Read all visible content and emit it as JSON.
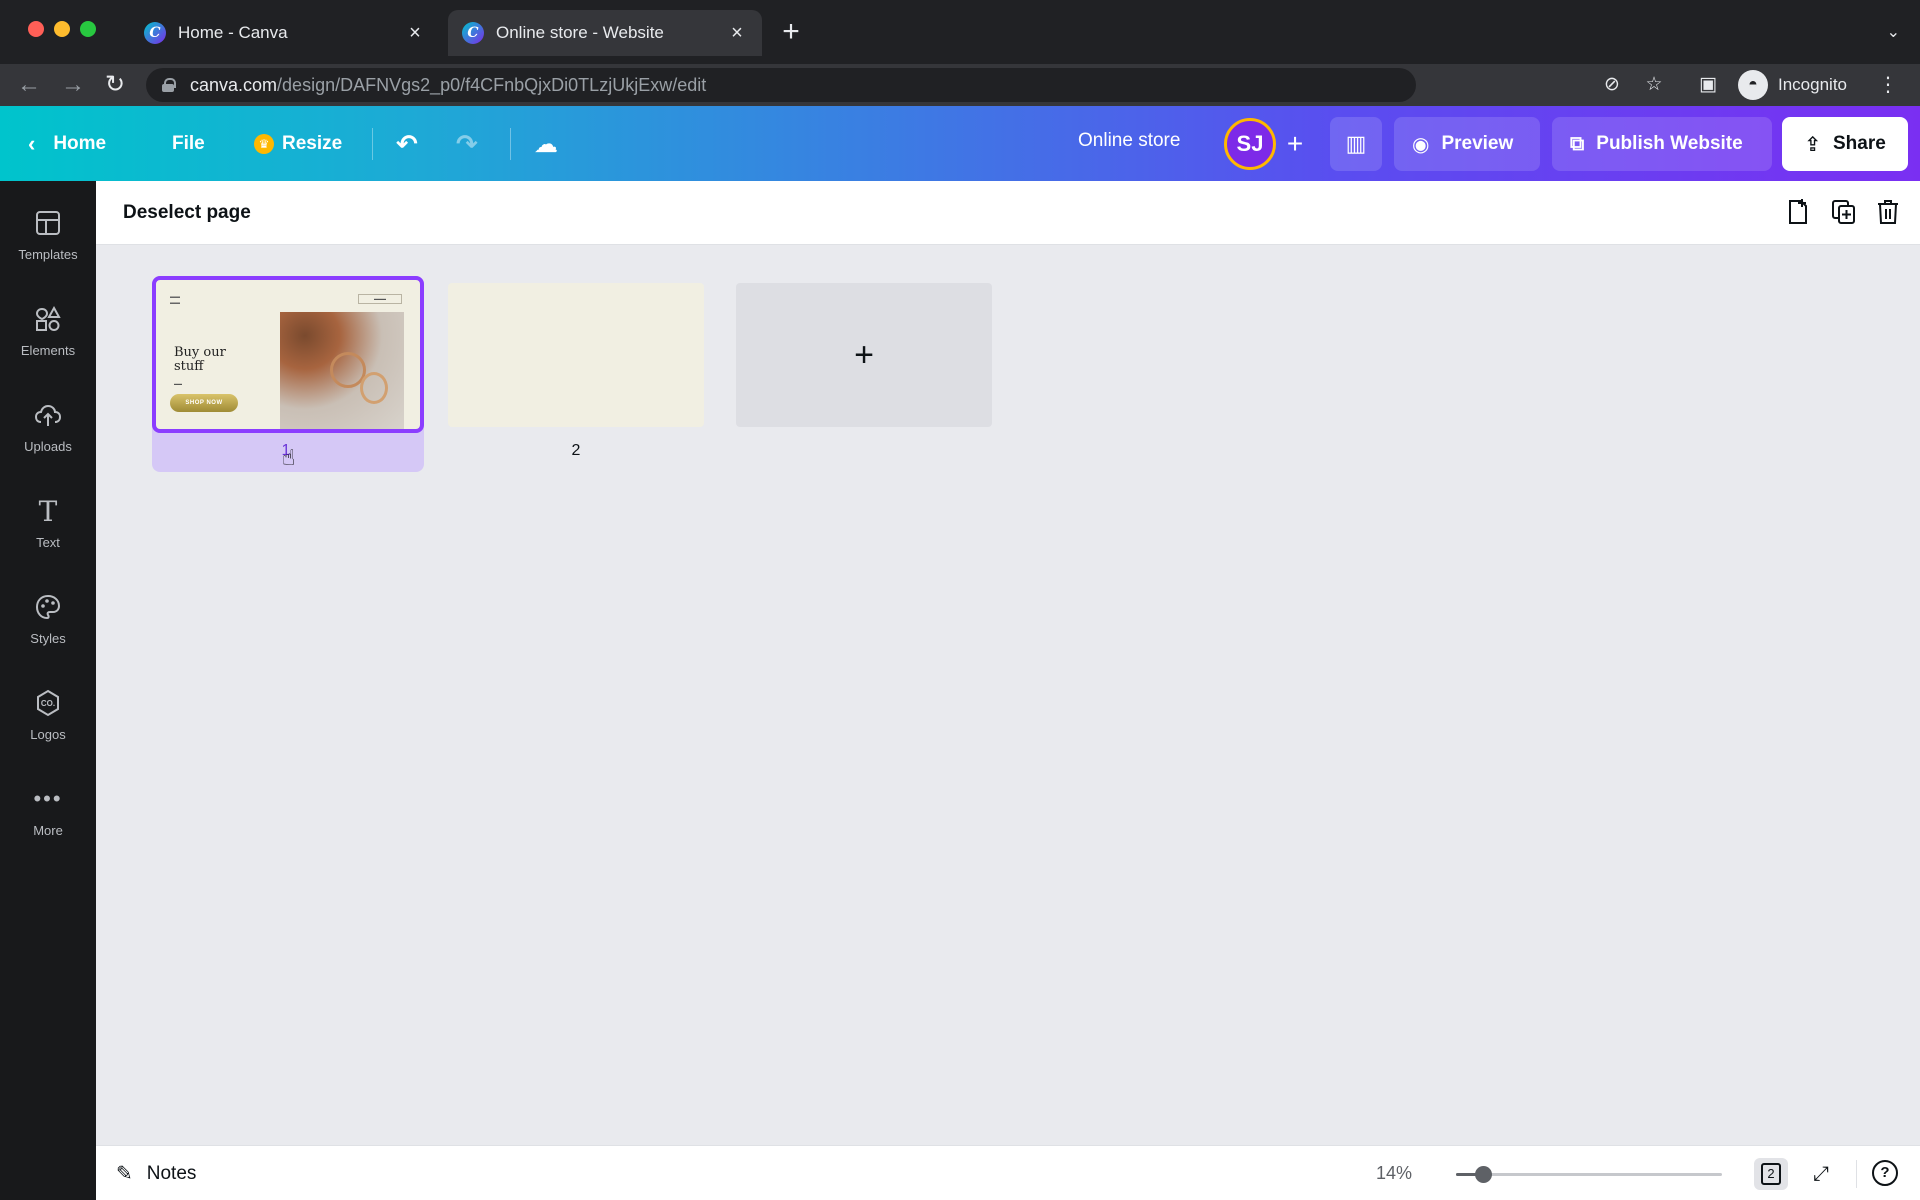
{
  "browser": {
    "tabs": [
      {
        "title": "Home - Canva",
        "active": false
      },
      {
        "title": "Online store - Website",
        "active": true
      }
    ],
    "url_domain": "canva.com",
    "url_path": "/design/DAFNVgs2_p0/f4CFnbQjxDi0TLzjUkjExw/edit",
    "profile_label": "Incognito"
  },
  "header": {
    "home_label": "Home",
    "file_label": "File",
    "resize_label": "Resize",
    "design_title": "Online store",
    "avatar_initials": "SJ",
    "preview_label": "Preview",
    "publish_label": "Publish Website",
    "share_label": "Share"
  },
  "sidebar": {
    "items": [
      {
        "label": "Templates",
        "icon": "templates-icon"
      },
      {
        "label": "Elements",
        "icon": "elements-icon"
      },
      {
        "label": "Uploads",
        "icon": "uploads-icon"
      },
      {
        "label": "Text",
        "icon": "text-icon"
      },
      {
        "label": "Styles",
        "icon": "styles-icon"
      },
      {
        "label": "Logos",
        "icon": "logos-icon"
      },
      {
        "label": "More",
        "icon": "more-icon"
      }
    ]
  },
  "page_toolbar": {
    "deselect_label": "Deselect page"
  },
  "pages": [
    {
      "number": "1",
      "selected": true,
      "thumbnail": {
        "headline": "Buy our stuff",
        "button": "SHOP NOW"
      }
    },
    {
      "number": "2",
      "selected": false
    }
  ],
  "footer": {
    "notes_label": "Notes",
    "zoom": "14%",
    "zoom_level": 0.1,
    "page_count": "2"
  },
  "colors": {
    "accent": "#8b3dff",
    "sidebar_bg": "#18191b",
    "header_gradient_start": "#00c4cc",
    "header_gradient_end": "#7a2ff2"
  }
}
